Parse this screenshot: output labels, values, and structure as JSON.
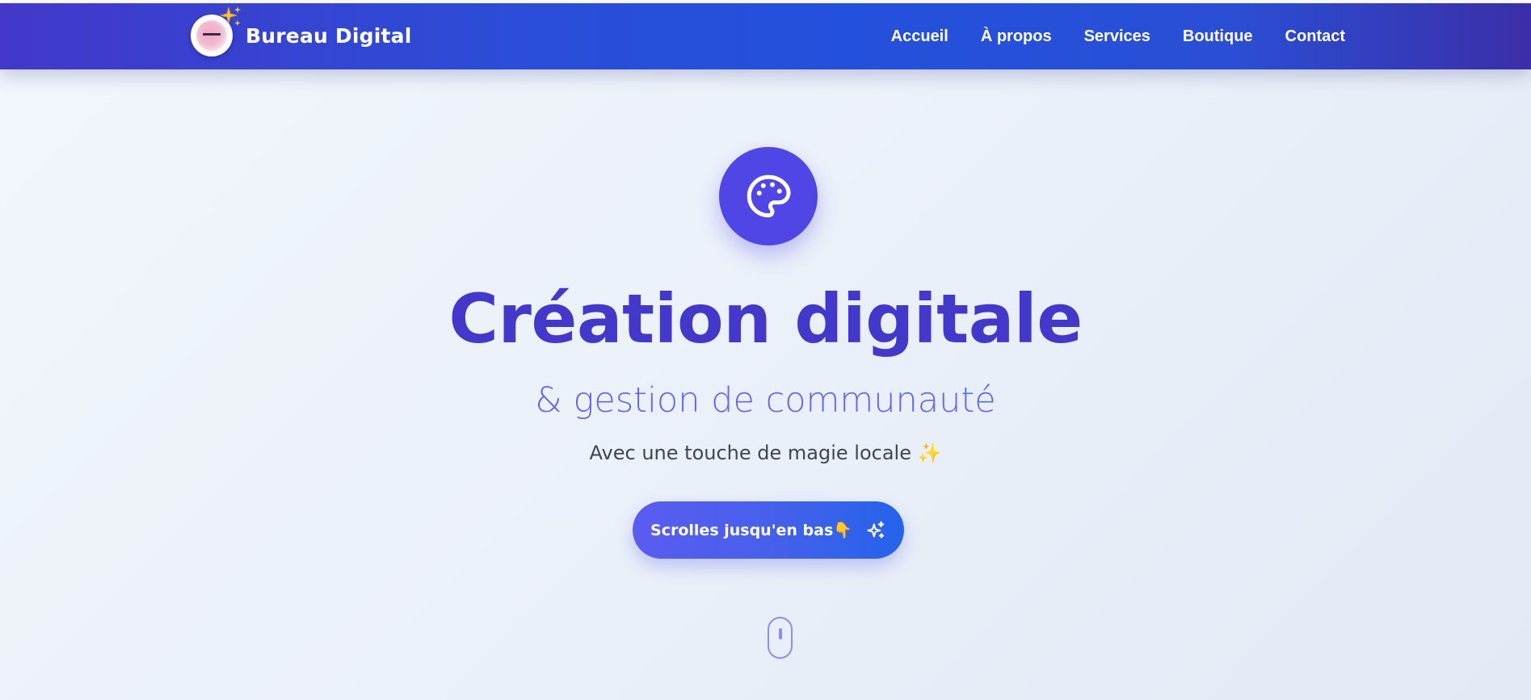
{
  "header": {
    "brand_name": "Bureau Digital",
    "logo_icon": "sparkle-icon",
    "nav": [
      {
        "label": "Accueil"
      },
      {
        "label": "À propos"
      },
      {
        "label": "Services"
      },
      {
        "label": "Boutique"
      },
      {
        "label": "Contact"
      }
    ]
  },
  "hero": {
    "icon": "palette-icon",
    "title": "Création digitale",
    "subtitle": "& gestion de communauté",
    "tagline": "Avec une touche de magie locale ✨",
    "cta_label": "Scrolles jusqu'en bas👇",
    "cta_icon": "sparkles-icon",
    "scroll_indicator_icon": "mouse-icon"
  },
  "colors": {
    "nav_gradient_start": "#4338ca",
    "nav_gradient_mid": "#2350dc",
    "accent": "#4f46e5",
    "title": "#4338ca",
    "subtitle": "#6366f1",
    "cta_end": "#2563eb"
  }
}
